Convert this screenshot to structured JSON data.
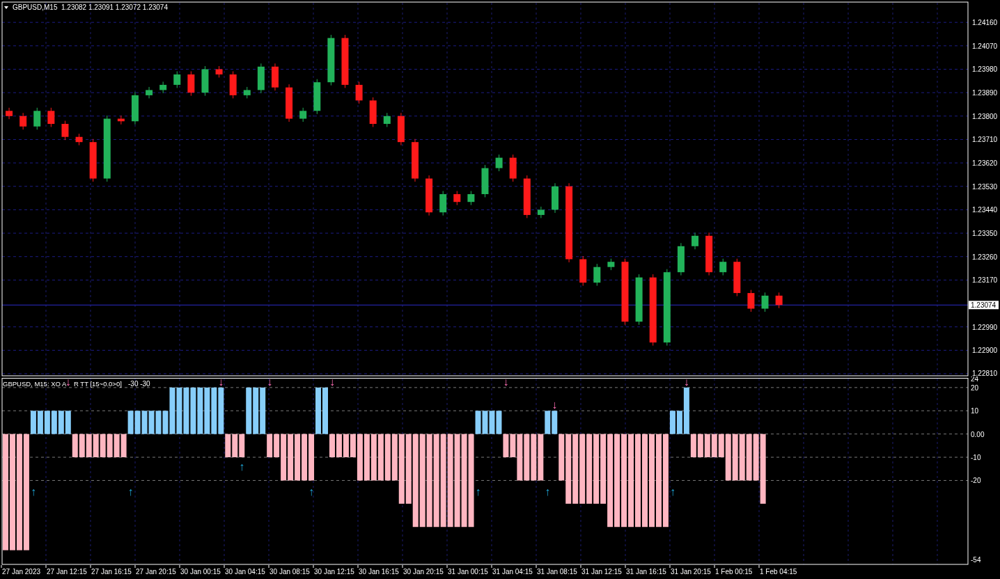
{
  "price_chart": {
    "title": "GBPUSD,M15  1.23082 1.23091 1.23072 1.23074",
    "chart_data": {
      "type": "candlestick",
      "grid": true,
      "ylim": [
        1.22802,
        1.24238
      ],
      "yticks": [
        {
          "value": 1.2416,
          "label": "1.24160"
        },
        {
          "value": 1.2407,
          "label": "1.24070"
        },
        {
          "value": 1.2398,
          "label": "1.23980"
        },
        {
          "value": 1.2389,
          "label": "1.23890"
        },
        {
          "value": 1.238,
          "label": "1.23800"
        },
        {
          "value": 1.2371,
          "label": "1.23710"
        },
        {
          "value": 1.2362,
          "label": "1.23620"
        },
        {
          "value": 1.2353,
          "label": "1.23530"
        },
        {
          "value": 1.2344,
          "label": "1.23440"
        },
        {
          "value": 1.2335,
          "label": "1.23350"
        },
        {
          "value": 1.2326,
          "label": "1.23260"
        },
        {
          "value": 1.2317,
          "label": "1.23170"
        },
        {
          "value": 1.2299,
          "label": "1.22990"
        },
        {
          "value": 1.229,
          "label": "1.22900"
        },
        {
          "value": 1.2281,
          "label": "1.22810"
        }
      ],
      "ref_lines": [
        {
          "axis": "y",
          "value": 1.23074,
          "label": "1.23074"
        }
      ],
      "categories": [
        null,
        null,
        null,
        null,
        null,
        null,
        null,
        null,
        null,
        null,
        null,
        null,
        null,
        null,
        null,
        null,
        null,
        null,
        null,
        null,
        null,
        null,
        null,
        null,
        null,
        null,
        null,
        null,
        null,
        null,
        null,
        null,
        null,
        null,
        null,
        null,
        null,
        null,
        null,
        null,
        null,
        null,
        null,
        null,
        null,
        null,
        null,
        null,
        null,
        null,
        null,
        null,
        null,
        null,
        null,
        null,
        null,
        null,
        null,
        null,
        null,
        null,
        null,
        null,
        null,
        null,
        null,
        null,
        null
      ],
      "ohlc": [
        [
          1.2382,
          1.23832,
          1.23788,
          1.238
        ],
        [
          1.238,
          1.23812,
          1.23748,
          1.2376
        ],
        [
          1.2376,
          1.23832,
          1.23748,
          1.2382
        ],
        [
          1.2382,
          1.23832,
          1.23758,
          1.2377
        ],
        [
          1.2377,
          1.23782,
          1.23708,
          1.2372
        ],
        [
          1.2372,
          1.23732,
          1.23688,
          1.237
        ],
        [
          1.237,
          1.23712,
          1.23548,
          1.2356
        ],
        [
          1.2356,
          1.23802,
          1.23548,
          1.2379
        ],
        [
          1.2379,
          1.23802,
          1.23768,
          1.2378
        ],
        [
          1.2378,
          1.23892,
          1.23768,
          1.2388
        ],
        [
          1.2388,
          1.23912,
          1.23868,
          1.239
        ],
        [
          1.239,
          1.23932,
          1.23888,
          1.2392
        ],
        [
          1.2392,
          1.23972,
          1.23908,
          1.2396
        ],
        [
          1.2396,
          1.23972,
          1.23878,
          1.2389
        ],
        [
          1.2389,
          1.23992,
          1.23878,
          1.2398
        ],
        [
          1.2398,
          1.23992,
          1.23948,
          1.2396
        ],
        [
          1.2396,
          1.23972,
          1.23868,
          1.2388
        ],
        [
          1.2388,
          1.23912,
          1.23868,
          1.239
        ],
        [
          1.239,
          1.24002,
          1.23888,
          1.2399
        ],
        [
          1.2399,
          1.24002,
          1.23898,
          1.2391
        ],
        [
          1.2391,
          1.23922,
          1.23778,
          1.2379
        ],
        [
          1.2379,
          1.23832,
          1.23778,
          1.2382
        ],
        [
          1.2382,
          1.23942,
          1.23808,
          1.2393
        ],
        [
          1.2393,
          1.24112,
          1.23918,
          1.241
        ],
        [
          1.241,
          1.24112,
          1.23908,
          1.2392
        ],
        [
          1.2392,
          1.23932,
          1.23848,
          1.2386
        ],
        [
          1.2386,
          1.23872,
          1.23758,
          1.2377
        ],
        [
          1.2377,
          1.23812,
          1.23758,
          1.238
        ],
        [
          1.238,
          1.23812,
          1.23688,
          1.237
        ],
        [
          1.237,
          1.23712,
          1.23548,
          1.2356
        ],
        [
          1.2356,
          1.23572,
          1.23418,
          1.2343
        ],
        [
          1.2343,
          1.23512,
          1.23418,
          1.235
        ],
        [
          1.235,
          1.23512,
          1.23458,
          1.2347
        ],
        [
          1.2347,
          1.23512,
          1.23458,
          1.235
        ],
        [
          1.235,
          1.23612,
          1.23488,
          1.236
        ],
        [
          1.236,
          1.23652,
          1.23588,
          1.2364
        ],
        [
          1.2364,
          1.23652,
          1.23548,
          1.2356
        ],
        [
          1.2356,
          1.23572,
          1.23408,
          1.2342
        ],
        [
          1.2342,
          1.23452,
          1.23408,
          1.2344
        ],
        [
          1.2344,
          1.23542,
          1.23428,
          1.2353
        ],
        [
          1.2353,
          1.23542,
          1.23238,
          1.2325
        ],
        [
          1.2325,
          1.23262,
          1.23148,
          1.2316
        ],
        [
          1.2316,
          1.23232,
          1.23148,
          1.2322
        ],
        [
          1.2322,
          1.23252,
          1.23208,
          1.2324
        ],
        [
          1.2324,
          1.23252,
          1.22998,
          1.2301
        ],
        [
          1.2301,
          1.23192,
          1.22998,
          1.2318
        ],
        [
          1.2318,
          1.23192,
          1.22918,
          1.2293
        ],
        [
          1.2293,
          1.23212,
          1.22918,
          1.232
        ],
        [
          1.232,
          1.23312,
          1.23188,
          1.233
        ],
        [
          1.233,
          1.23352,
          1.23288,
          1.2334
        ],
        [
          1.2334,
          1.23352,
          1.23188,
          1.232
        ],
        [
          1.232,
          1.23252,
          1.23188,
          1.2324
        ],
        [
          1.2324,
          1.23252,
          1.23108,
          1.2312
        ],
        [
          1.2312,
          1.23132,
          1.23048,
          1.2306
        ],
        [
          1.2306,
          1.23122,
          1.23048,
          1.2311
        ],
        [
          1.2311,
          1.23122,
          1.23062,
          1.23074
        ],
        null,
        null,
        null,
        null,
        null,
        null,
        null,
        null,
        null,
        null,
        null,
        null,
        null
      ]
    }
  },
  "indicator": {
    "title_parts": [
      "GBPUSD, M15: XO A",
      "R TT [15~0.0>0]"
    ],
    "readout": "-30 -30",
    "chart_data": {
      "type": "bar",
      "grid": true,
      "ylim": [
        -56.1,
        24
      ],
      "yticks": [
        {
          "value": 24,
          "label": "24"
        },
        {
          "value": 20,
          "label": "20"
        },
        {
          "value": 10,
          "label": "10"
        },
        {
          "value": 0,
          "label": "0.00"
        },
        {
          "value": -10,
          "label": "-10"
        },
        {
          "value": -20,
          "label": "-20"
        },
        {
          "value": -54,
          "label": "-54"
        }
      ],
      "categories": [
        null,
        null,
        null,
        null,
        null,
        null,
        null,
        null,
        null,
        null,
        null,
        null,
        null,
        null,
        null,
        null,
        null,
        null,
        null,
        null,
        null,
        null,
        null,
        null,
        null,
        null,
        null,
        null,
        null,
        null,
        null,
        null,
        null,
        null,
        null,
        null,
        null,
        null,
        null,
        null,
        null,
        null,
        null,
        null,
        null,
        null,
        null,
        null,
        null,
        null,
        null,
        null,
        null,
        null,
        null,
        null,
        null,
        null,
        null,
        null,
        null,
        null,
        null,
        null,
        null,
        null,
        null,
        null,
        null,
        null,
        null,
        null,
        null,
        null,
        null,
        null,
        null,
        null,
        null,
        null,
        null,
        null,
        null,
        null,
        null,
        null,
        null,
        null,
        null,
        null,
        null,
        null,
        null,
        null,
        null,
        null,
        null,
        null,
        null,
        null,
        null,
        null,
        null,
        null,
        null,
        null,
        null,
        null,
        null,
        null,
        null,
        null,
        null,
        null,
        null,
        null,
        null,
        null,
        null,
        null,
        null,
        null,
        null,
        null,
        null,
        null,
        null,
        null,
        null,
        null,
        null,
        null,
        null,
        null,
        null,
        null,
        null,
        null,
        null
      ],
      "values": [
        -50,
        -50,
        -50,
        -50,
        10,
        10,
        10,
        10,
        10,
        10,
        -10,
        -10,
        -10,
        -10,
        -10,
        -10,
        -10,
        -10,
        10,
        10,
        10,
        10,
        10,
        10,
        20,
        20,
        20,
        20,
        20,
        20,
        20,
        20,
        -10,
        -10,
        -10,
        20,
        20,
        20,
        -10,
        -10,
        -20,
        -20,
        -20,
        -20,
        -20,
        20,
        20,
        -10,
        -10,
        -10,
        -10,
        -20,
        -20,
        -20,
        -20,
        -20,
        -20,
        -30,
        -30,
        -40,
        -40,
        -40,
        -40,
        -40,
        -40,
        -40,
        -40,
        -40,
        10,
        10,
        10,
        10,
        -10,
        -10,
        -20,
        -20,
        -20,
        -20,
        10,
        10,
        -20,
        -30,
        -30,
        -30,
        -30,
        -30,
        -30,
        -40,
        -40,
        -40,
        -40,
        -40,
        -40,
        -40,
        -40,
        -40,
        10,
        10,
        20,
        -10,
        -10,
        -10,
        -10,
        -10,
        -20,
        -20,
        -20,
        -20,
        -20,
        -30,
        null,
        null,
        null,
        null,
        null,
        null,
        null,
        null,
        null,
        null,
        null,
        null,
        null,
        null,
        null,
        null,
        null,
        null,
        null,
        null,
        null,
        null,
        null,
        null,
        null,
        null,
        null,
        null,
        null
      ]
    },
    "bar_signals": [
      {
        "kind": "none"
      },
      {
        "kind": "none"
      },
      {
        "kind": "none"
      },
      {
        "kind": "none"
      },
      {
        "kind": "up",
        "text": "↑"
      },
      {
        "kind": "none"
      },
      {
        "kind": "none"
      },
      {
        "kind": "none"
      },
      {
        "kind": "none"
      },
      {
        "kind": "down",
        "text": "↓"
      },
      {
        "kind": "none"
      },
      {
        "kind": "none"
      },
      {
        "kind": "none"
      },
      {
        "kind": "none"
      },
      {
        "kind": "none"
      },
      {
        "kind": "none"
      },
      {
        "kind": "none"
      },
      {
        "kind": "none"
      },
      {
        "kind": "up",
        "text": "↑"
      },
      {
        "kind": "none"
      },
      {
        "kind": "none"
      },
      {
        "kind": "none"
      },
      {
        "kind": "none"
      },
      {
        "kind": "none"
      },
      {
        "kind": "none"
      },
      {
        "kind": "none"
      },
      {
        "kind": "none"
      },
      {
        "kind": "none"
      },
      {
        "kind": "none"
      },
      {
        "kind": "none"
      },
      {
        "kind": "none"
      },
      {
        "kind": "down",
        "text": "↓"
      },
      {
        "kind": "none"
      },
      {
        "kind": "none"
      },
      {
        "kind": "up_at_bar",
        "text": "↑"
      },
      {
        "kind": "none"
      },
      {
        "kind": "none"
      },
      {
        "kind": "none"
      },
      {
        "kind": "down",
        "text": "↓"
      },
      {
        "kind": "none"
      },
      {
        "kind": "none"
      },
      {
        "kind": "none"
      },
      {
        "kind": "none"
      },
      {
        "kind": "none"
      },
      {
        "kind": "up",
        "text": "↑"
      },
      {
        "kind": "none"
      },
      {
        "kind": "none"
      },
      {
        "kind": "down",
        "text": "↓"
      },
      {
        "kind": "none"
      },
      {
        "kind": "none"
      },
      {
        "kind": "none"
      },
      {
        "kind": "none"
      },
      {
        "kind": "none"
      },
      {
        "kind": "none"
      },
      {
        "kind": "none"
      },
      {
        "kind": "none"
      },
      {
        "kind": "none"
      },
      {
        "kind": "none"
      },
      {
        "kind": "none"
      },
      {
        "kind": "none"
      },
      {
        "kind": "none"
      },
      {
        "kind": "none"
      },
      {
        "kind": "none"
      },
      {
        "kind": "none"
      },
      {
        "kind": "none"
      },
      {
        "kind": "none"
      },
      {
        "kind": "none"
      },
      {
        "kind": "none"
      },
      {
        "kind": "up",
        "text": "↑"
      },
      {
        "kind": "none"
      },
      {
        "kind": "none"
      },
      {
        "kind": "none"
      },
      {
        "kind": "down",
        "text": "↓"
      },
      {
        "kind": "none"
      },
      {
        "kind": "none"
      },
      {
        "kind": "none"
      },
      {
        "kind": "none"
      },
      {
        "kind": "none"
      },
      {
        "kind": "up",
        "text": "↑"
      },
      {
        "kind": "down_at_bar",
        "text": "↓"
      },
      {
        "kind": "none"
      },
      {
        "kind": "none"
      },
      {
        "kind": "none"
      },
      {
        "kind": "none"
      },
      {
        "kind": "none"
      },
      {
        "kind": "none"
      },
      {
        "kind": "none"
      },
      {
        "kind": "none"
      },
      {
        "kind": "none"
      },
      {
        "kind": "none"
      },
      {
        "kind": "none"
      },
      {
        "kind": "none"
      },
      {
        "kind": "none"
      },
      {
        "kind": "none"
      },
      {
        "kind": "none"
      },
      {
        "kind": "none"
      },
      {
        "kind": "up",
        "text": "↑"
      },
      {
        "kind": "none"
      },
      {
        "kind": "down",
        "text": "↓"
      }
    ]
  },
  "time_axis": {
    "labels": [
      "27 Jan 2023",
      "27 Jan 12:15",
      "27 Jan 16:15",
      "27 Jan 20:15",
      "30 Jan 00:15",
      "30 Jan 04:15",
      "30 Jan 08:15",
      "30 Jan 12:15",
      "30 Jan 16:15",
      "30 Jan 20:15",
      "31 Jan 00:15",
      "31 Jan 04:15",
      "31 Jan 08:15",
      "31 Jan 12:15",
      "31 Jan 16:15",
      "31 Jan 20:15",
      "1 Feb 00:15",
      "1 Feb 04:15"
    ]
  }
}
